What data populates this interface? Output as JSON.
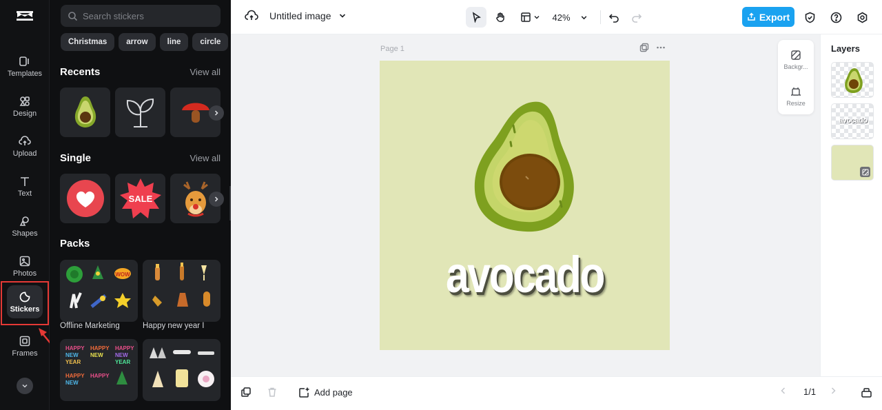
{
  "rail": {
    "items": [
      {
        "label": "Templates",
        "icon": "templates-icon"
      },
      {
        "label": "Design",
        "icon": "design-icon"
      },
      {
        "label": "Upload",
        "icon": "upload-icon"
      },
      {
        "label": "Text",
        "icon": "text-icon"
      },
      {
        "label": "Shapes",
        "icon": "shapes-icon"
      },
      {
        "label": "Photos",
        "icon": "photos-icon"
      },
      {
        "label": "Stickers",
        "icon": "stickers-icon",
        "active": true
      },
      {
        "label": "Frames",
        "icon": "frames-icon"
      }
    ]
  },
  "panel": {
    "search_placeholder": "Search stickers",
    "chips": [
      "Christmas",
      "arrow",
      "line",
      "circle"
    ],
    "recents": {
      "title": "Recents",
      "view_all": "View all",
      "items": [
        "avocado-sticker",
        "sprout-sticker",
        "mushroom-sticker"
      ]
    },
    "single": {
      "title": "Single",
      "view_all": "View all",
      "items": [
        "heart-sticker",
        "sale-sticker",
        "reindeer-sticker"
      ]
    },
    "packs": {
      "title": "Packs",
      "items": [
        {
          "label": "Offline Marketing"
        },
        {
          "label": "Happy new year I"
        },
        {
          "label": ""
        },
        {
          "label": ""
        }
      ]
    }
  },
  "topbar": {
    "title": "Untitled image",
    "zoom": "42%",
    "export_label": "Export"
  },
  "canvas": {
    "page_label": "Page 1",
    "sticker_text": "avocado",
    "background_color": "#e1e6b7"
  },
  "float_tools": {
    "background_label": "Backgr...",
    "resize_label": "Resize"
  },
  "layers": {
    "title": "Layers",
    "text_layer_label": "avocado"
  },
  "bottombar": {
    "add_page_label": "Add page",
    "page_counter": "1/1"
  },
  "colors": {
    "accent": "#1aa2f0",
    "highlight": "#e53935",
    "panel_bg": "#0f1012"
  }
}
